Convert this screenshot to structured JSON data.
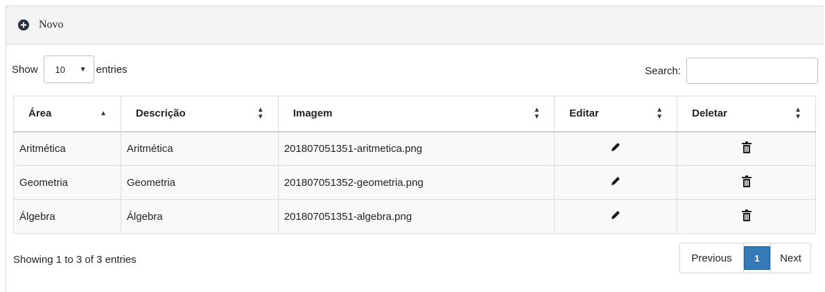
{
  "header": {
    "new_label": "Novo"
  },
  "length": {
    "show": "Show",
    "value": "10",
    "entries": "entries"
  },
  "search": {
    "label": "Search:",
    "value": ""
  },
  "columns": [
    "Área",
    "Descrição",
    "Imagem",
    "Editar",
    "Deletar"
  ],
  "rows": [
    {
      "area": "Aritmética",
      "descricao": "Aritmética",
      "imagem": "201807051351-aritmetica.png"
    },
    {
      "area": "Geometria",
      "descricao": "Geometria",
      "imagem": "201807051352-geometria.png"
    },
    {
      "area": "Álgebra",
      "descricao": "Álgebra",
      "imagem": "201807051351-algebra.png"
    }
  ],
  "footer": {
    "info": "Showing 1 to 3 of 3 entries"
  },
  "pagination": {
    "previous": "Previous",
    "current": "1",
    "next": "Next"
  },
  "icons": {
    "new": "plus-circle-icon",
    "edit": "pencil-icon",
    "delete": "trash-icon",
    "sort_asc": "caret-up-icon",
    "sort_both": "sort-icon"
  },
  "colors": {
    "accent": "#337ab7"
  }
}
